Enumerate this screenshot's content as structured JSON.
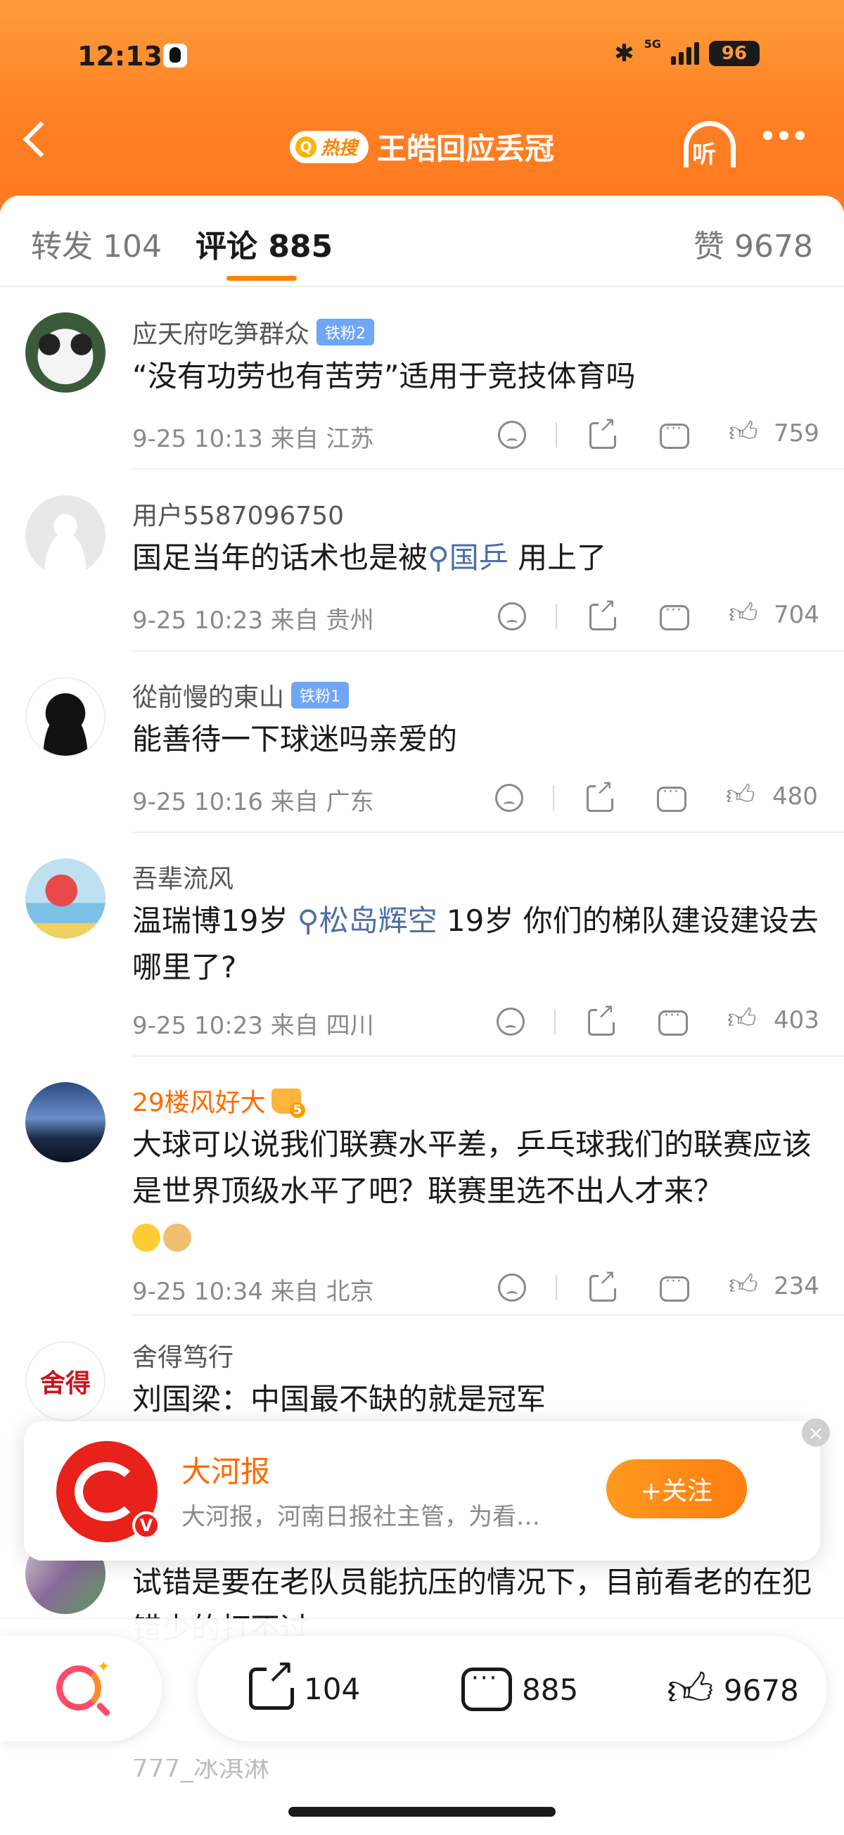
{
  "status": {
    "time": "12:13",
    "network": "5G",
    "battery": "96"
  },
  "header": {
    "hot_label": "热搜",
    "title": "王皓回应丢冠",
    "listen_label": "听"
  },
  "tabs": [
    {
      "label": "转发 104"
    },
    {
      "label": "评论 885"
    },
    {
      "label": "赞 9678"
    }
  ],
  "comments": [
    {
      "user": "应天府吃笋群众",
      "badge": "铁粉2",
      "text": "“没有功劳也有苦劳”适用于竞技体育吗",
      "time": "9-25 10:13",
      "location": "来自 江苏",
      "likes": "759"
    },
    {
      "user": "用户5587096750",
      "text_before": "国足当年的话术也是被",
      "topic": "国乒",
      "text_after": " 用上了",
      "time": "9-25 10:23",
      "location": "来自 贵州",
      "likes": "704"
    },
    {
      "user": "從前慢的東山",
      "badge": "铁粉1",
      "text": "能善待一下球迷吗亲爱的",
      "time": "9-25 10:16",
      "location": "来自 广东",
      "likes": "480"
    },
    {
      "user": "吾辈流风",
      "text_before": "温瑞博19岁  ",
      "topic": "松岛辉空",
      "text_after": " 19岁  你们的梯队建设建设去哪里了?",
      "time": "9-25 10:23",
      "location": "来自 四川",
      "likes": "403"
    },
    {
      "user": "29楼风好大",
      "text": "大球可以说我们联赛水平差，乒乓球我们的联赛应该是世界顶级水平了吧？联赛里选不出人才来？",
      "time": "9-25 10:34",
      "location": "来自 北京",
      "likes": "234"
    },
    {
      "user": "舍得笃行",
      "avatar_text": "舍得",
      "text": "刘国梁：中国最不缺的就是冠军"
    },
    {
      "text": "试错是要在老队员能抗压的情况下，目前看老的在犯错少的打不过"
    },
    {
      "user": "777_冰淇淋"
    }
  ],
  "follow_card": {
    "name": "大河报",
    "desc": "大河报，河南日报社主管，为看…",
    "follow_label": "+关注",
    "verified": "V"
  },
  "bottom_bar": {
    "reposts": "104",
    "comments": "885",
    "likes": "9678"
  },
  "colors": {
    "brand": "#ff8200",
    "topic": "#4d6fa8",
    "vip_name": "#ff6a00"
  }
}
